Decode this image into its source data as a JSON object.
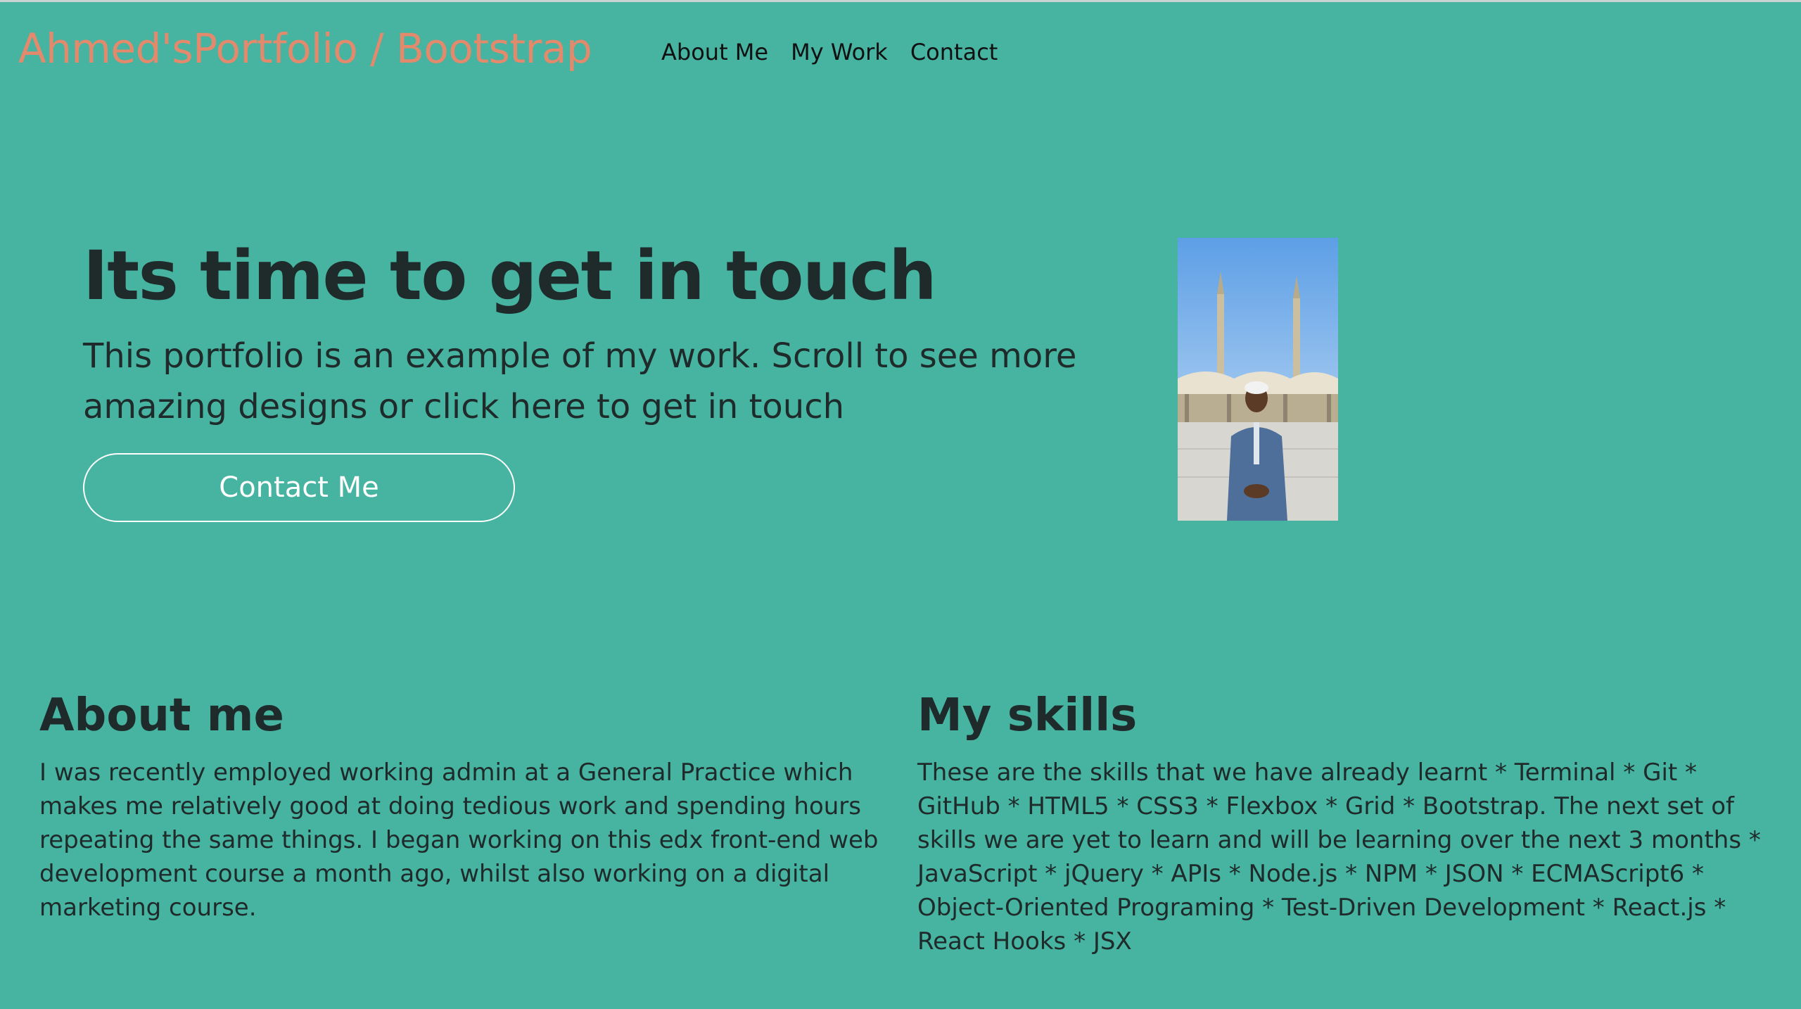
{
  "navbar": {
    "brand": "Ahmed'sPortfolio / Bootstrap",
    "links": [
      "About Me",
      "My Work",
      "Contact"
    ]
  },
  "hero": {
    "title": "Its time to get in touch",
    "subtitle": "This portfolio is an example of my work. Scroll to see more amazing designs or click here to get in touch",
    "button_label": "Contact Me"
  },
  "about": {
    "title": "About me",
    "body": "I was recently employed working admin at a General Practice which makes me relatively good at doing tedious work and spending hours repeating the same things. I began working on this edx front-end web development course a month ago, whilst also working on a digital marketing course."
  },
  "skills": {
    "title": "My skills",
    "body": "These are the skills that we have already learnt * Terminal * Git * GitHub * HTML5 * CSS3 * Flexbox * Grid * Bootstrap. The next set of skills we are yet to learn and will be learning over the next 3 months * JavaScript * jQuery * APIs * Node.js * NPM * JSON * ECMAScript6 * Object-Oriented Programing * Test-Driven Development * React.js * React Hooks * JSX"
  },
  "colors": {
    "background": "#47b3a1",
    "brand": "#e48a6c",
    "text": "#1f2a2a",
    "button_text": "#ffffff"
  }
}
